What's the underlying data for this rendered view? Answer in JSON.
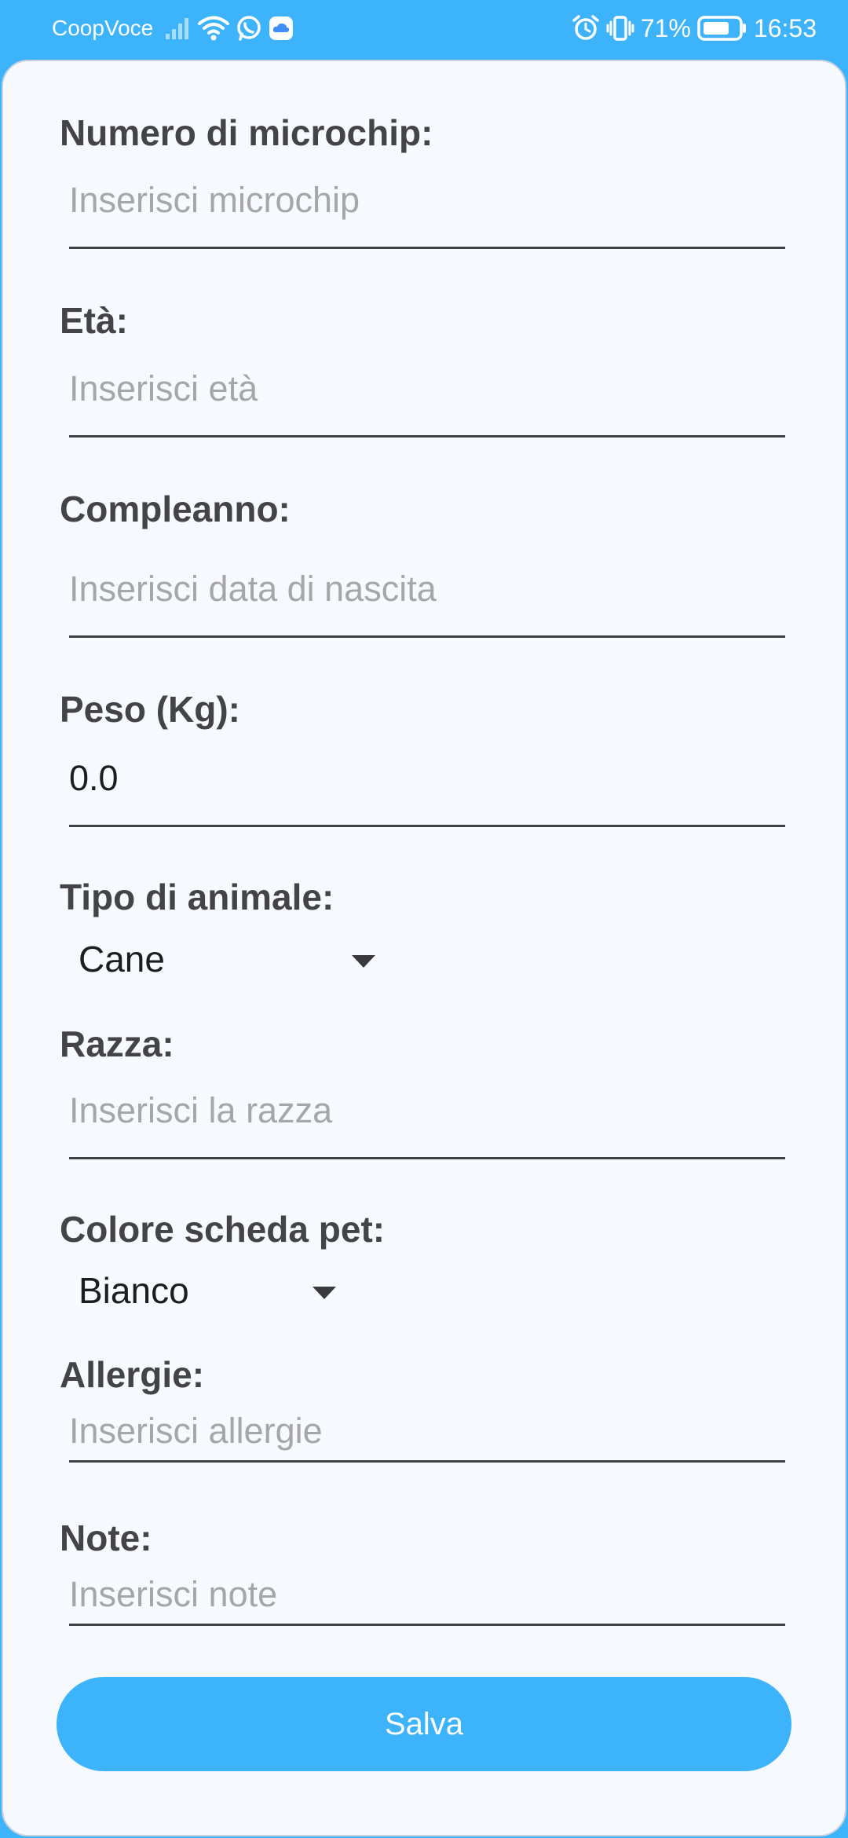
{
  "status_bar": {
    "carrier": "CoopVoce",
    "battery_percent": "71%",
    "time": "16:53",
    "icons": [
      "signal-icon",
      "wifi-icon",
      "whatsapp-icon",
      "cloud-icon",
      "alarm-icon",
      "vibrate-icon",
      "battery-icon"
    ]
  },
  "form": {
    "microchip": {
      "label": "Numero di microchip:",
      "placeholder": "Inserisci microchip"
    },
    "eta": {
      "label": "Età:",
      "placeholder": "Inserisci età"
    },
    "compleanno": {
      "label": "Compleanno:",
      "placeholder": "Inserisci data di nascita"
    },
    "peso": {
      "label": "Peso (Kg):",
      "value": "0.0"
    },
    "tipo_animale": {
      "label": "Tipo di animale:",
      "selected": "Cane"
    },
    "razza": {
      "label": "Razza:",
      "placeholder": "Inserisci la razza"
    },
    "colore": {
      "label": "Colore scheda pet:",
      "selected": "Bianco"
    },
    "allergie": {
      "label": "Allergie:",
      "placeholder": "Inserisci allergie"
    },
    "note": {
      "label": "Note:",
      "placeholder": "Inserisci note"
    },
    "save_label": "Salva"
  },
  "colors": {
    "accent": "#3db3fb",
    "background": "#f6f9fe",
    "label": "#444447",
    "placeholder": "#a6a6a8"
  }
}
